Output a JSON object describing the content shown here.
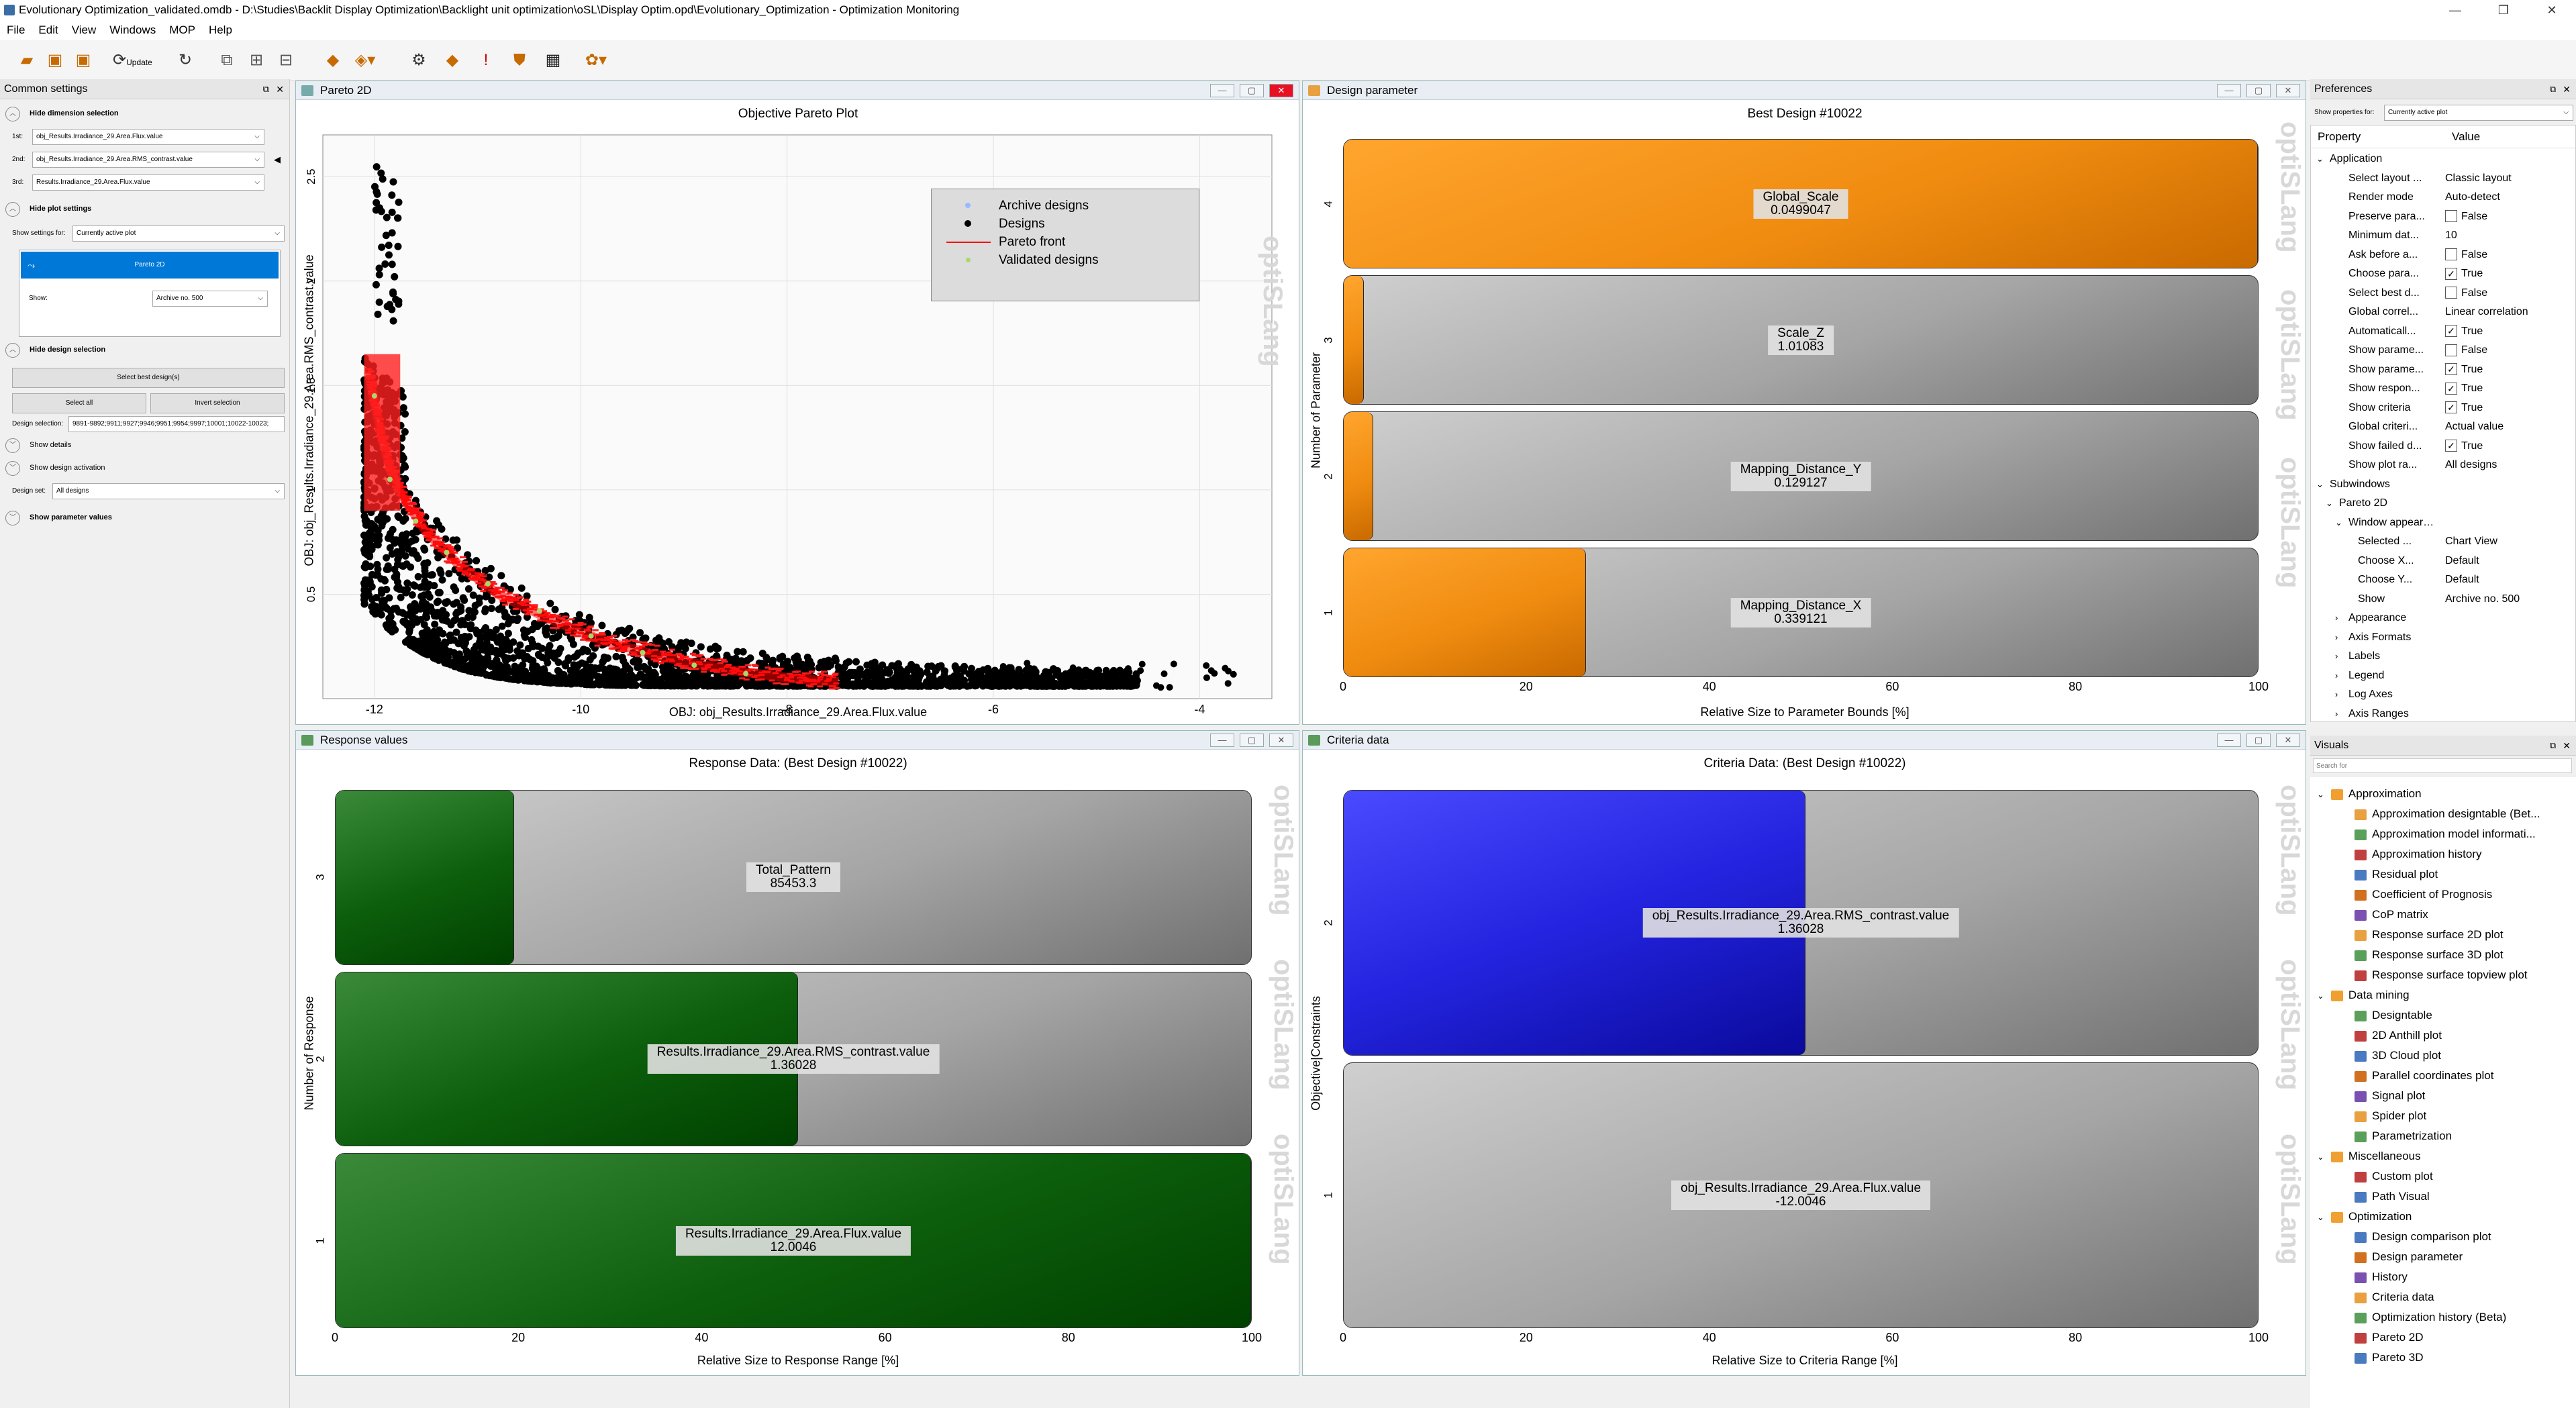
{
  "window": {
    "title": "Evolutionary Optimization_validated.omdb - D:\\Studies\\Backlit Display Optimization\\Backlight unit optimization\\oSL\\Display Optim.opd\\Evolutionary_Optimization - Optimization Monitoring"
  },
  "menu": [
    "File",
    "Edit",
    "View",
    "Windows",
    "MOP",
    "Help"
  ],
  "toolbar": {
    "update_label": "Update"
  },
  "common_settings": {
    "title": "Common settings",
    "hide_dimension_selection": "Hide dimension selection",
    "dim1_label": "1st:",
    "dim1_value": "obj_Results.Irradiance_29.Area.Flux.value",
    "dim2_label": "2nd:",
    "dim2_value": "obj_Results.Irradiance_29.Area.RMS_contrast.value",
    "dim3_label": "3rd:",
    "dim3_value": "Results.Irradiance_29.Area.Flux.value",
    "hide_plot_settings": "Hide plot settings",
    "show_settings_for_label": "Show settings for:",
    "show_settings_for_value": "Currently active plot",
    "plot_item": "Pareto 2D",
    "show_label": "Show:",
    "show_value": "Archive no. 500",
    "hide_design_selection": "Hide design selection",
    "select_best": "Select best design(s)",
    "select_all": "Select all",
    "invert_selection": "Invert selection",
    "design_selection_label": "Design selection:",
    "design_selection_value": "9891-9892;9911;9927;9946;9951;9954;9997;10001;10022-10023;",
    "show_details": "Show details",
    "show_design_activation": "Show design activation",
    "design_set_label": "Design set:",
    "design_set_value": "All designs",
    "show_parameter_values": "Show parameter values"
  },
  "pareto": {
    "window_title": "Pareto 2D",
    "plot_title": "Objective Pareto Plot",
    "xlabel": "OBJ: obj_Results.Irradiance_29.Area.Flux.value",
    "ylabel": "OBJ: obj_Results.Irradiance_29.Area.RMS_contrast.value",
    "xticks": [
      "-12",
      "-10",
      "-8",
      "-6",
      "-4"
    ],
    "yticks": [
      "0.5",
      "1",
      "1.5",
      "2",
      "2.5"
    ],
    "legend": [
      "Archive designs",
      "Designs",
      "Pareto front",
      "Validated designs"
    ],
    "watermark": "optiSLang"
  },
  "chart_data": [
    {
      "type": "scatter",
      "title": "Objective Pareto Plot",
      "xlabel": "OBJ: obj_Results.Irradiance_29.Area.Flux.value",
      "ylabel": "OBJ: obj_Results.Irradiance_29.Area.RMS_contrast.value",
      "xlim": [
        -12.5,
        -3.3
      ],
      "ylim": [
        0.0,
        2.7
      ],
      "legend_position": "top-right",
      "series": [
        {
          "name": "Pareto front",
          "x": [
            -12.05,
            -11.95,
            -11.85,
            -11.7,
            -11.5,
            -11.2,
            -10.8,
            -10.3,
            -9.8,
            -9.2,
            -8.6,
            -8.0,
            -7.5
          ],
          "y": [
            1.55,
            1.3,
            1.1,
            0.95,
            0.8,
            0.65,
            0.5,
            0.38,
            0.28,
            0.2,
            0.14,
            0.1,
            0.08
          ]
        },
        {
          "name": "Validated designs",
          "x": [
            -12.0,
            -11.85,
            -11.6,
            -11.3,
            -10.9,
            -10.4,
            -9.9,
            -9.4,
            -8.9,
            -8.4
          ],
          "y": [
            1.45,
            1.05,
            0.85,
            0.7,
            0.55,
            0.42,
            0.3,
            0.22,
            0.16,
            0.12
          ]
        }
      ]
    },
    {
      "type": "bar",
      "title": "Best Design #10022",
      "xlabel": "Relative Size to Parameter Bounds [%]",
      "ylabel": "Number of Parameter",
      "xlim": [
        0,
        100
      ],
      "categories": [
        "1",
        "2",
        "3",
        "4"
      ],
      "values": [
        26.5,
        3.2,
        2.2,
        100
      ],
      "labels": [
        "Mapping_Distance_X",
        "Mapping_Distance_Y",
        "Scale_Z",
        "Global_Scale"
      ],
      "value_labels": [
        "0.339121",
        "0.129127",
        "1.01083",
        "0.0499047"
      ]
    },
    {
      "type": "bar",
      "title": "Response Data: (Best Design #10022)",
      "xlabel": "Relative Size to Response Range [%]",
      "ylabel": "Number of Response",
      "xlim": [
        0,
        100
      ],
      "categories": [
        "1",
        "2",
        "3"
      ],
      "values": [
        100,
        50.5,
        19.5
      ],
      "labels": [
        "Results.Irradiance_29.Area.Flux.value",
        "Results.Irradiance_29.Area.RMS_contrast.value",
        "Total_Pattern"
      ],
      "value_labels": [
        "12.0046",
        "1.36028",
        "85453.3"
      ]
    },
    {
      "type": "bar",
      "title": "Criteria Data: (Best Design #10022)",
      "xlabel": "Relative Size to Criteria Range [%]",
      "ylabel": "Objective|Constraints",
      "xlim": [
        0,
        100
      ],
      "categories": [
        "1",
        "2"
      ],
      "values": [
        0,
        50.5
      ],
      "labels": [
        "obj_Results.Irradiance_29.Area.Flux.value",
        "obj_Results.Irradiance_29.Area.RMS_contrast.value"
      ],
      "value_labels": [
        "-12.0046",
        "1.36028"
      ]
    }
  ],
  "design_parameter": {
    "window_title": "Design parameter",
    "plot_title": "Best Design #10022",
    "xlabel": "Relative Size to Parameter Bounds [%]",
    "ylabel": "Number of Parameter"
  },
  "response_values": {
    "window_title": "Response values",
    "plot_title": "Response Data: (Best Design #10022)",
    "xlabel": "Relative Size to Response Range [%]",
    "ylabel": "Number of Response"
  },
  "criteria_data": {
    "window_title": "Criteria data",
    "plot_title": "Criteria Data: (Best Design #10022)",
    "xlabel": "Relative Size to Criteria Range [%]",
    "ylabel": "Objective|Constraints"
  },
  "bar_xticks": [
    "0",
    "20",
    "40",
    "60",
    "80",
    "100"
  ],
  "preferences": {
    "title": "Preferences",
    "show_props_label": "Show properties for:",
    "show_props_value": "Currently active plot",
    "col_property": "Property",
    "col_value": "Value",
    "rows": [
      {
        "k": "Application",
        "v": "",
        "lvl": 0,
        "exp": "v"
      },
      {
        "k": "Select layout ...",
        "v": "Classic layout",
        "lvl": 2
      },
      {
        "k": "Render mode",
        "v": "Auto-detect",
        "lvl": 2
      },
      {
        "k": "Preserve para...",
        "v": "False",
        "lvl": 2,
        "chk": " "
      },
      {
        "k": "Minimum dat...",
        "v": "10",
        "lvl": 2
      },
      {
        "k": "Ask before a...",
        "v": "False",
        "lvl": 2,
        "chk": " "
      },
      {
        "k": "Choose para...",
        "v": "True",
        "lvl": 2,
        "chk": "✓"
      },
      {
        "k": "Select best d...",
        "v": "False",
        "lvl": 2,
        "chk": " "
      },
      {
        "k": "Global correl...",
        "v": "Linear correlation",
        "lvl": 2
      },
      {
        "k": "Automaticall...",
        "v": "True",
        "lvl": 2,
        "chk": "✓"
      },
      {
        "k": "Show parame...",
        "v": "False",
        "lvl": 2,
        "chk": " "
      },
      {
        "k": "Show parame...",
        "v": "True",
        "lvl": 2,
        "chk": "✓"
      },
      {
        "k": "Show respon...",
        "v": "True",
        "lvl": 2,
        "chk": "✓"
      },
      {
        "k": "Show criteria",
        "v": "True",
        "lvl": 2,
        "chk": "✓"
      },
      {
        "k": "Global criteri...",
        "v": "Actual value",
        "lvl": 2
      },
      {
        "k": "Show failed d...",
        "v": "True",
        "lvl": 2,
        "chk": "✓"
      },
      {
        "k": "Show plot ra...",
        "v": "All designs",
        "lvl": 2
      },
      {
        "k": "Subwindows",
        "v": "",
        "lvl": 0,
        "exp": "v"
      },
      {
        "k": "Pareto 2D",
        "v": "",
        "lvl": 1,
        "exp": "v"
      },
      {
        "k": "Window appearance",
        "v": "",
        "lvl": 2,
        "exp": "v"
      },
      {
        "k": "Selected ...",
        "v": "Chart View",
        "lvl": 3
      },
      {
        "k": "Choose X...",
        "v": "Default",
        "lvl": 3
      },
      {
        "k": "Choose Y...",
        "v": "Default",
        "lvl": 3
      },
      {
        "k": "Show",
        "v": "Archive no. 500",
        "lvl": 3
      },
      {
        "k": "Appearance",
        "v": "",
        "lvl": 2,
        "exp": ">"
      },
      {
        "k": "Axis Formats",
        "v": "",
        "lvl": 2,
        "exp": ">"
      },
      {
        "k": "Labels",
        "v": "",
        "lvl": 2,
        "exp": ">"
      },
      {
        "k": "Legend",
        "v": "",
        "lvl": 2,
        "exp": ">"
      },
      {
        "k": "Log Axes",
        "v": "",
        "lvl": 2,
        "exp": ">"
      },
      {
        "k": "Axis Ranges",
        "v": "",
        "lvl": 2,
        "exp": ">"
      }
    ]
  },
  "visuals": {
    "title": "Visuals",
    "search_placeholder": "Search for",
    "groups": [
      {
        "name": "Approximation",
        "items": [
          "Approximation designtable (Bet...",
          "Approximation model informati...",
          "Approximation history",
          "Residual plot",
          "Coefficient of Prognosis",
          "CoP matrix",
          "Response surface 2D plot",
          "Response surface 3D plot",
          "Response surface topview plot"
        ]
      },
      {
        "name": "Data mining",
        "items": [
          "Designtable",
          "2D Anthill plot",
          "3D Cloud plot",
          "Parallel coordinates plot",
          "Signal plot",
          "Spider plot",
          "Parametrization"
        ]
      },
      {
        "name": "Miscellaneous",
        "items": [
          "Custom plot",
          "Path Visual"
        ]
      },
      {
        "name": "Optimization",
        "items": [
          "Design comparison plot",
          "Design parameter",
          "History",
          "Criteria data",
          "Optimization history (Beta)",
          "Pareto 2D",
          "Pareto 3D"
        ]
      }
    ]
  },
  "colors": {
    "orange": "#f08c10",
    "green": "#0c5e0c",
    "blue": "#2424e0",
    "pareto_red": "#ff0000",
    "validated": "#a8d86a"
  }
}
